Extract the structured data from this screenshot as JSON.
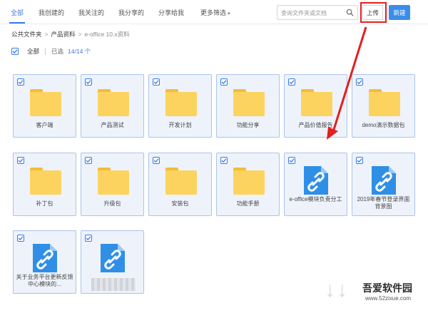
{
  "tabs": [
    {
      "label": "全部",
      "active": true
    },
    {
      "label": "我创建的"
    },
    {
      "label": "我关注的"
    },
    {
      "label": "我分享的"
    },
    {
      "label": "分享给我"
    },
    {
      "label": "更多筛选"
    }
  ],
  "search": {
    "placeholder": "查询文件夹或文档"
  },
  "toolbar": {
    "upload_label": "上传",
    "new_label": "新建"
  },
  "breadcrumb": [
    "公共文件夹",
    "产品资料",
    "e-office 10.x资料"
  ],
  "selection": {
    "all_label": "全部",
    "selected_label": "已选",
    "count": "14/14 个"
  },
  "items": [
    {
      "name": "客户端",
      "type": "folder"
    },
    {
      "name": "产品测试",
      "type": "folder"
    },
    {
      "name": "开发计划",
      "type": "folder"
    },
    {
      "name": "功能分享",
      "type": "folder"
    },
    {
      "name": "产品价值报告",
      "type": "folder"
    },
    {
      "name": "demo演示数据包",
      "type": "folder"
    },
    {
      "name": "补丁包",
      "type": "folder"
    },
    {
      "name": "升级包",
      "type": "folder"
    },
    {
      "name": "安装包",
      "type": "folder"
    },
    {
      "name": "功能手册",
      "type": "folder"
    },
    {
      "name": "e-office模块负责分工",
      "type": "link"
    },
    {
      "name": "2019年春节登录界面背景图",
      "type": "link"
    },
    {
      "name": "关于业务平台更新反馈中心模块的...",
      "type": "link"
    },
    {
      "name": "",
      "type": "link",
      "blurred": true
    }
  ],
  "watermark": {
    "brand": "吾爱软件园",
    "url": "www.52zixue.com"
  },
  "colors": {
    "accent": "#3a7ae8",
    "highlight": "#e21f1f",
    "folder": "#fdd35f",
    "file": "#2f8fe6"
  }
}
